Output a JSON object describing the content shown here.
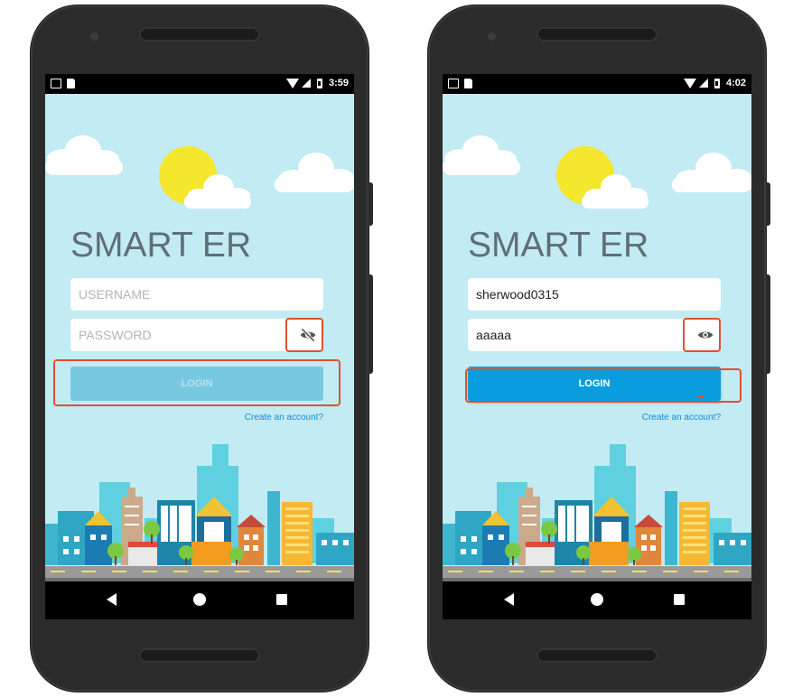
{
  "colors": {
    "sky": "#c2ebf3",
    "accent": "#0a9ddd",
    "login_disabled": "#79c8e2",
    "highlight": "#e0502e",
    "link": "#1a8ad7"
  },
  "screens": [
    {
      "status": {
        "time": "3:59"
      },
      "title": "SMART ER",
      "username": {
        "value": "",
        "placeholder": "USERNAME"
      },
      "password": {
        "value": "",
        "placeholder": "PASSWORD",
        "visibility_icon": "eye-off-icon"
      },
      "login_label": "LOGIN",
      "login_state": "disabled",
      "create_account": "Create an account?"
    },
    {
      "status": {
        "time": "4:02"
      },
      "title": "SMART ER",
      "username": {
        "value": "sherwood0315",
        "placeholder": "USERNAME"
      },
      "password": {
        "value": "aaaaa",
        "placeholder": "PASSWORD",
        "visibility_icon": "eye-icon"
      },
      "login_label": "LOGIN",
      "login_state": "enabled",
      "create_account": "Create an account?"
    }
  ],
  "nav": {
    "icons": [
      "back-icon",
      "home-icon",
      "recents-icon"
    ]
  }
}
